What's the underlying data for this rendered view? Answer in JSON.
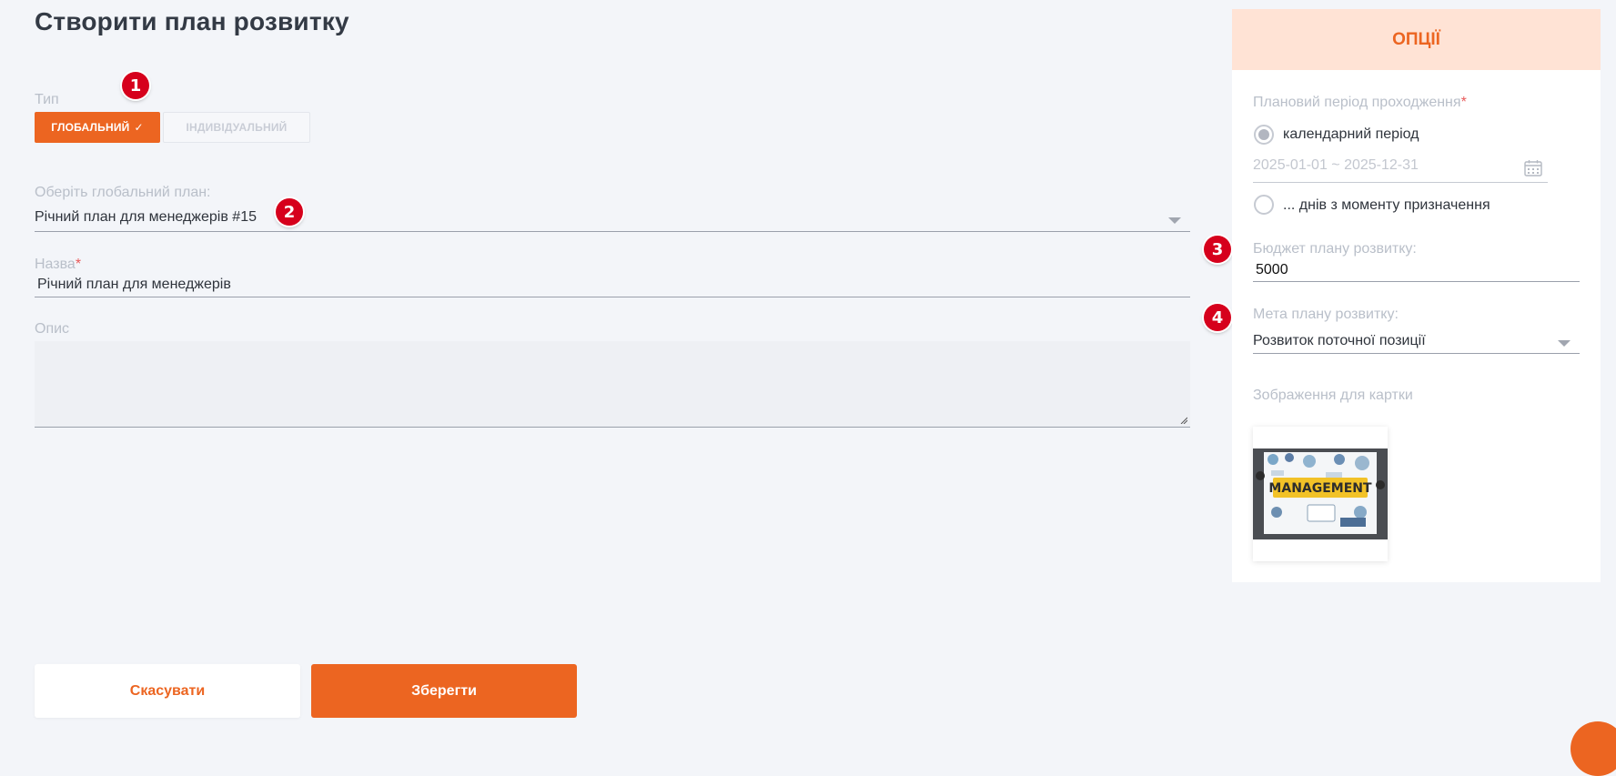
{
  "page": {
    "title": "Створити план розвитку"
  },
  "markers": [
    "1",
    "2",
    "3",
    "4"
  ],
  "type_selector": {
    "label": "Тип",
    "options": [
      {
        "label": "ГЛОБАЛЬНИЙ",
        "selected": true
      },
      {
        "label": "ІНДИВІДУАЛЬНИЙ",
        "selected": false
      }
    ],
    "check_icon": "✓"
  },
  "global_plan": {
    "label": "Оберіть глобальний план:",
    "value": "Річний план для менеджерів #15"
  },
  "name_field": {
    "label": "Назва",
    "required_mark": "*",
    "value": "Річний план для менеджерів"
  },
  "description": {
    "label": "Опис",
    "value": ""
  },
  "options_panel": {
    "title": "ОПЦІЇ",
    "period_label": "Плановий період проходження",
    "period_required_mark": "*",
    "calendar_option": "календарний період",
    "date_range": "2025-01-01 ~ 2025-12-31",
    "days_option": "... днів з моменту призначення",
    "budget_label": "Бюджет плану розвитку:",
    "budget_value": "5000",
    "goal_label": "Мета плану розвитку:",
    "goal_value": "Розвиток поточної позиції",
    "image_label": "Зображення для картки",
    "image_text": "MANAGEMENT"
  },
  "actions": {
    "cancel": "Скасувати",
    "save": "Зберегти"
  },
  "colors": {
    "accent": "#ec6521",
    "header_bg": "#ffe3d5",
    "page_bg": "#f3f5f9",
    "marker": "#d6001c"
  }
}
